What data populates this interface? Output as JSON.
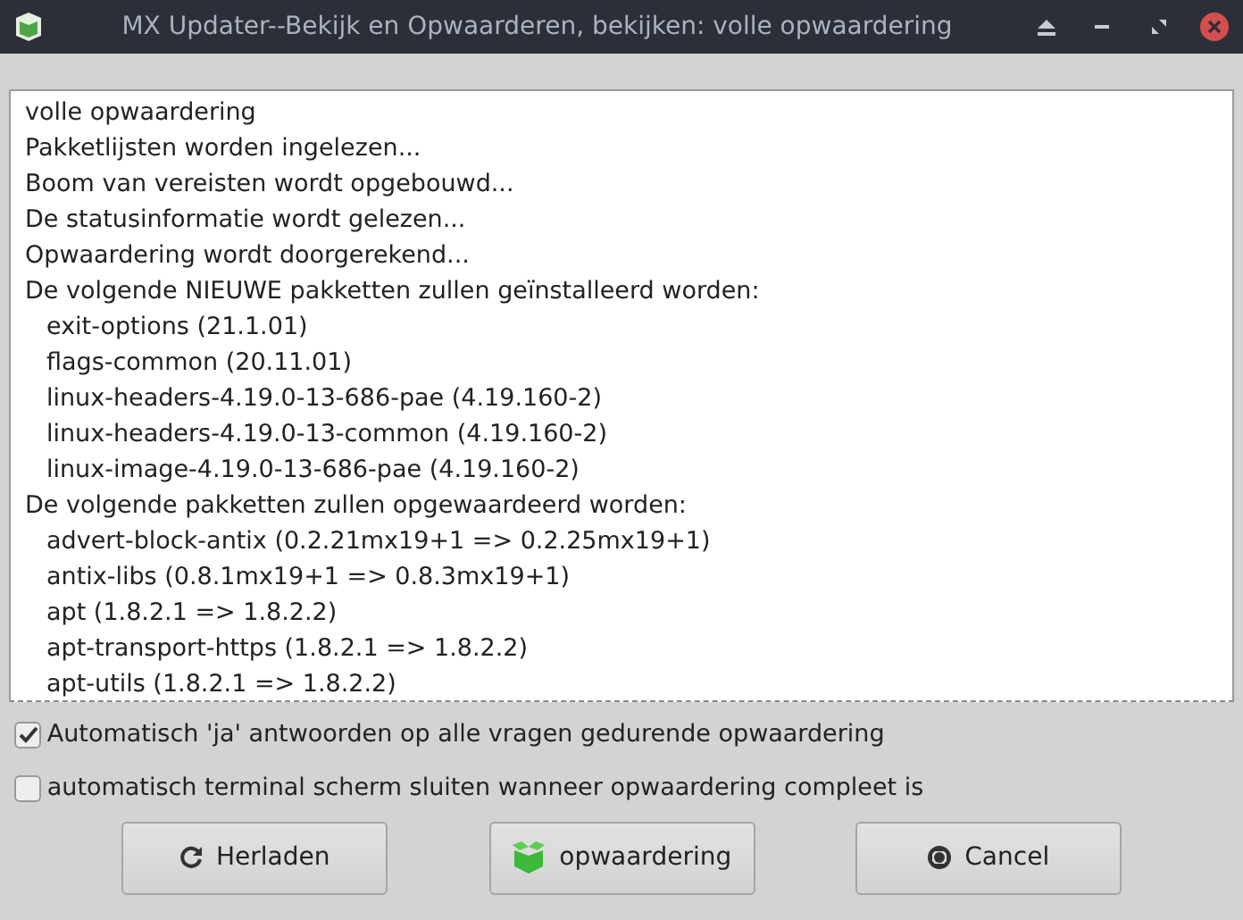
{
  "window": {
    "title": "MX Updater--Bekijk en Opwaarderen, bekijken: volle opwaardering"
  },
  "log": [
    {
      "kind": "line",
      "text": "volle opwaardering"
    },
    {
      "kind": "line",
      "text": "Pakketlijsten worden ingelezen..."
    },
    {
      "kind": "line",
      "text": "Boom van vereisten wordt opgebouwd..."
    },
    {
      "kind": "line",
      "text": "De statusinformatie wordt gelezen..."
    },
    {
      "kind": "line",
      "text": "Opwaardering wordt doorgerekend..."
    },
    {
      "kind": "line",
      "text": "De volgende NIEUWE pakketten zullen geïnstalleerd worden:"
    },
    {
      "kind": "package",
      "text": "exit-options (21.1.01)"
    },
    {
      "kind": "package",
      "text": "flags-common (20.11.01)"
    },
    {
      "kind": "package",
      "text": "linux-headers-4.19.0-13-686-pae (4.19.160-2)"
    },
    {
      "kind": "package",
      "text": "linux-headers-4.19.0-13-common (4.19.160-2)"
    },
    {
      "kind": "package",
      "text": "linux-image-4.19.0-13-686-pae (4.19.160-2)"
    },
    {
      "kind": "line",
      "text": "De volgende pakketten zullen opgewaardeerd worden:"
    },
    {
      "kind": "package",
      "text": "advert-block-antix (0.2.21mx19+1 => 0.2.25mx19+1)"
    },
    {
      "kind": "package",
      "text": "antix-libs (0.8.1mx19+1 => 0.8.3mx19+1)"
    },
    {
      "kind": "package",
      "text": "apt (1.8.2.1 => 1.8.2.2)"
    },
    {
      "kind": "package",
      "text": "apt-transport-https (1.8.2.1 => 1.8.2.2)"
    },
    {
      "kind": "package",
      "text": "apt-utils (1.8.2.1 => 1.8.2.2)"
    }
  ],
  "options": [
    {
      "label": "Automatisch 'ja' antwoorden op alle vragen gedurende opwaardering",
      "checked": true
    },
    {
      "label": "automatisch terminal scherm sluiten wanneer opwaardering compleet is",
      "checked": false
    }
  ],
  "buttons": [
    {
      "kind": "reload",
      "label": "Herladen"
    },
    {
      "kind": "upgrade",
      "label": "opwaardering"
    },
    {
      "kind": "cancel",
      "label": "Cancel"
    }
  ]
}
